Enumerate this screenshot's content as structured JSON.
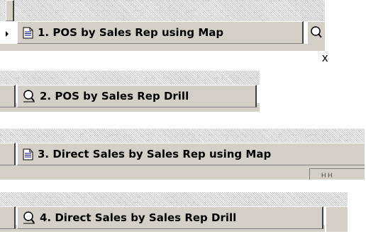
{
  "tabs": [
    {
      "label": "1.  POS by Sales Rep using Map",
      "icon": "document-icon"
    },
    {
      "label": "2.  POS by Sales Rep Drill",
      "icon": "magnifier-icon"
    },
    {
      "label": "3.  Direct Sales by Sales Rep using Map",
      "icon": "document-icon"
    },
    {
      "label": "4.  Direct Sales by Sales Rep Drill",
      "icon": "magnifier-icon"
    }
  ],
  "close_mark": "x",
  "clipped_text": "H H",
  "colors": {
    "face": "#d4d0c8",
    "highlight": "#ffffff",
    "shadow": "#808080",
    "dark": "#404040"
  }
}
